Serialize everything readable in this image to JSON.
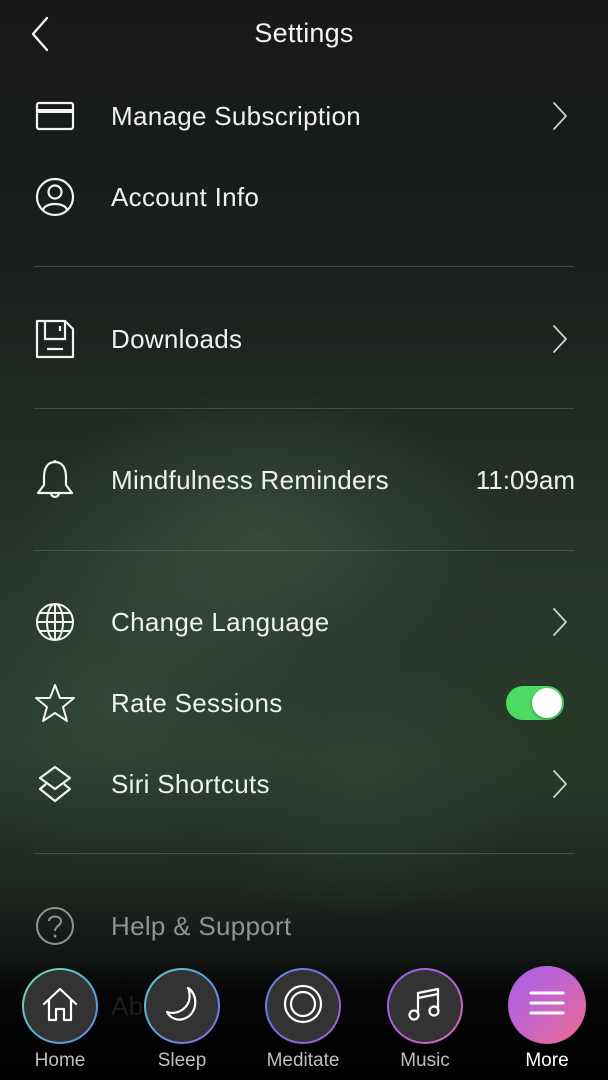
{
  "header": {
    "title": "Settings",
    "back_icon": "chevron-left-icon"
  },
  "settings": {
    "manage_subscription": {
      "label": "Manage Subscription",
      "icon": "credit-card-icon",
      "chevron": true
    },
    "account_info": {
      "label": "Account Info",
      "icon": "user-circle-icon"
    },
    "downloads": {
      "label": "Downloads",
      "icon": "floppy-disk-icon",
      "chevron": true
    },
    "mindfulness_reminders": {
      "label": "Mindfulness Reminders",
      "icon": "bell-icon",
      "value": "11:09am"
    },
    "change_language": {
      "label": "Change Language",
      "icon": "globe-icon",
      "chevron": true
    },
    "rate_sessions": {
      "label": "Rate Sessions",
      "icon": "star-icon",
      "toggle_on": true
    },
    "siri_shortcuts": {
      "label": "Siri Shortcuts",
      "icon": "siri-shortcuts-icon",
      "chevron": true
    },
    "help_support": {
      "label": "Help & Support",
      "icon": "question-circle-icon"
    },
    "about": {
      "label": "About"
    }
  },
  "toggle_color": "#4cd964",
  "nav": {
    "items": [
      {
        "label": "Home",
        "icon": "home-icon",
        "active": false
      },
      {
        "label": "Sleep",
        "icon": "moon-icon",
        "active": false
      },
      {
        "label": "Meditate",
        "icon": "meditate-rings-icon",
        "active": false
      },
      {
        "label": "Music",
        "icon": "music-note-icon",
        "active": false
      },
      {
        "label": "More",
        "icon": "menu-lines-icon",
        "active": true
      }
    ]
  }
}
